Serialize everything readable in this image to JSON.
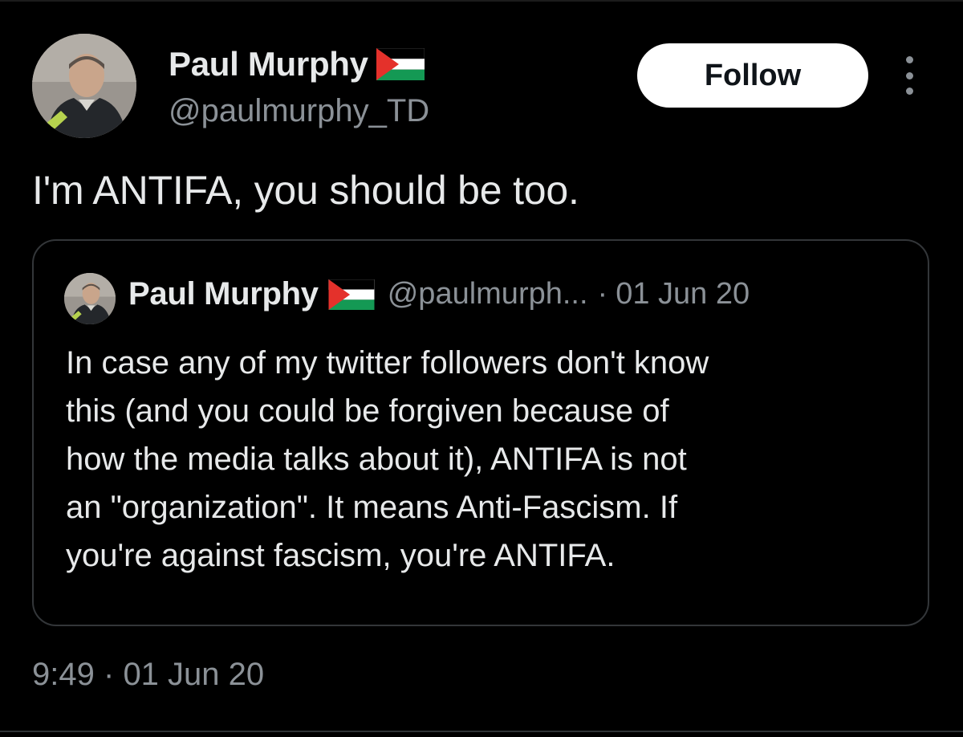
{
  "author": {
    "display_name": "Paul Murphy",
    "handle": "@paulmurphy_TD",
    "flag_icon": "palestine-flag-icon"
  },
  "actions": {
    "follow_label": "Follow",
    "more_icon": "more-vertical-icon"
  },
  "tweet": {
    "text": "I'm ANTIFA, you should be too.",
    "time": "9:49",
    "separator": "·",
    "date": "01 Jun 20"
  },
  "quote": {
    "display_name": "Paul Murphy",
    "handle": "@paulmurph...",
    "separator": "·",
    "date": "01 Jun 20",
    "lines": [
      "In case any of my twitter followers don't know",
      "this (and you could be forgiven because of",
      "how the media talks about it), ANTIFA is not",
      "an \"organization\". It means Anti-Fascism. If",
      "you're against fascism, you're ANTIFA."
    ]
  },
  "colors": {
    "background": "#000000",
    "text_primary": "#e7e9ea",
    "text_secondary": "#8b9197",
    "border": "#333639",
    "button_bg": "#ffffff",
    "flag_green": "#149954",
    "flag_red": "#e4312b"
  }
}
